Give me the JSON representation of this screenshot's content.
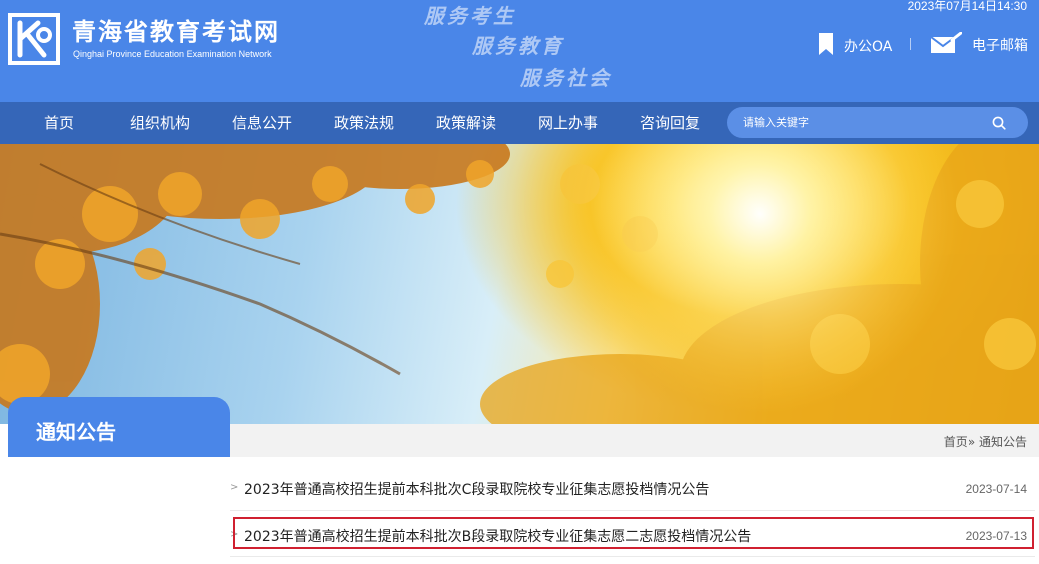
{
  "header": {
    "title": "青海省教育考试网",
    "subtitle": "Qinghai Province Education Examination Network",
    "slogans": [
      "服务考生",
      "服务教育",
      "服务社会"
    ],
    "datetime": "2023年07月14日14:30",
    "links": {
      "oa": "办公OA",
      "mail": "电子邮箱"
    },
    "icons": {
      "logo": "logo-mark",
      "oa": "bookmark-icon",
      "mail": "mail-icon"
    }
  },
  "nav": {
    "items": [
      "首页",
      "组织机构",
      "信息公开",
      "政策法规",
      "政策解读",
      "网上办事",
      "咨询回复"
    ],
    "search": {
      "placeholder": "请输入关键字",
      "icon": "search-icon"
    }
  },
  "section": {
    "title": "通知公告",
    "breadcrumb": {
      "home": "首页",
      "separator": "»",
      "current": "通知公告"
    }
  },
  "news": [
    {
      "bullet": ">",
      "title": "2023年普通高校招生提前本科批次C段录取院校专业征集志愿投档情况公告",
      "date": "2023-07-14"
    },
    {
      "bullet": ">",
      "title": "2023年普通高校招生提前本科批次B段录取院校专业征集志愿二志愿投档情况公告",
      "date": "2023-07-13",
      "highlighted": true
    }
  ],
  "colors": {
    "header_bg": "#4a86e8",
    "nav_bg": "#3566b8",
    "highlight_border": "#d02030"
  }
}
